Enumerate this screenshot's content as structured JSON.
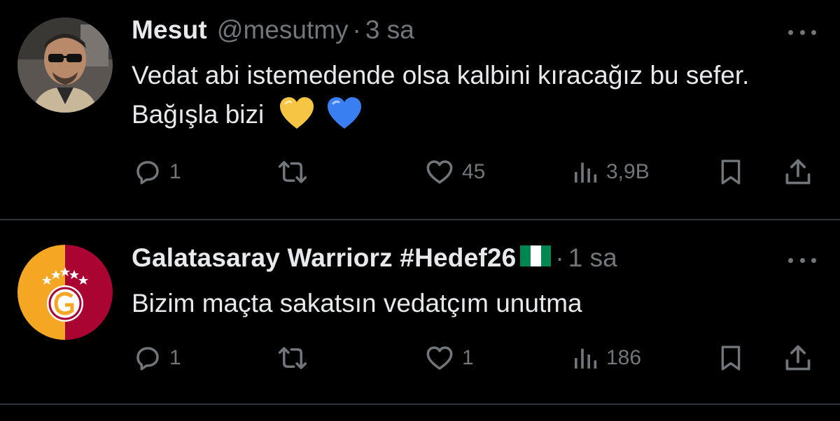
{
  "tweets": [
    {
      "author_name": "Mesut",
      "handle": "@mesutmy",
      "separator": "·",
      "time": "3 sa",
      "text": "Vedat abi istemedende olsa kalbini kıracağız bu sefer. Bağışla bizi",
      "emojis": [
        "yellow-heart",
        "blue-heart"
      ],
      "replies": "1",
      "likes": "45",
      "views": "3,9B"
    },
    {
      "author_name": "Galatasaray Warriorz #Hedef26",
      "flag": "nigeria-flag",
      "handle": "",
      "separator": "·",
      "time": "1 sa",
      "text": "Bizim maçta sakatsın vedatçım unutma",
      "replies": "1",
      "likes": "1",
      "views": "186"
    }
  ],
  "colors": {
    "background": "#000000",
    "text": "#e7e9ea",
    "muted": "#71767b",
    "divider": "#2f3336",
    "gs_yellow": "#f5a623",
    "gs_red": "#a90432"
  },
  "icons": [
    "reply-icon",
    "retweet-icon",
    "like-icon",
    "views-icon",
    "bookmark-icon",
    "share-icon",
    "more-icon"
  ]
}
